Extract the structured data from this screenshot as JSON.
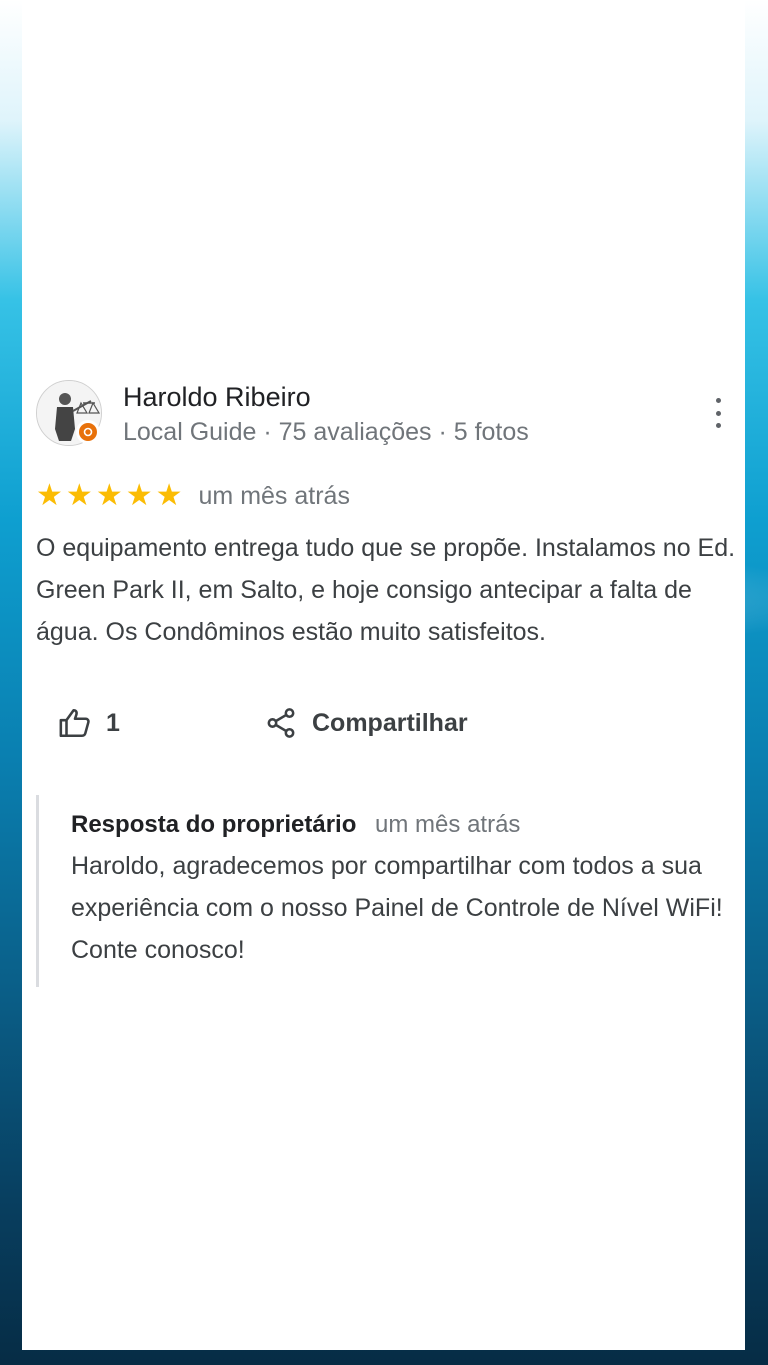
{
  "review": {
    "author": "Haroldo Ribeiro",
    "author_meta": "Local Guide · 75 avaliações · 5 fotos",
    "rating": 5,
    "time": "um mês atrás",
    "text": "O equipamento entrega tudo que se propõe. Instalamos no Ed. Green Park II, em Salto, e hoje consigo antecipar a falta de água. Os Condôminos estão muito satisfeitos.",
    "likes": "1",
    "share_label": "Compartilhar"
  },
  "owner_reply": {
    "title": "Resposta do proprietário",
    "time": "um mês atrás",
    "text": "Haroldo, agradecemos por compartilhar com todos a sua experiência com o nosso Painel de Controle de Nível WiFi! Conte conosco!"
  },
  "icons": {
    "avatar": "statue-avatar",
    "badge": "local-guide-badge-icon",
    "menu": "more-vert-icon",
    "star": "star-icon",
    "like": "thumb-up-icon",
    "share": "share-icon"
  },
  "colors": {
    "star": "#fbbc04",
    "badge": "#e8710a",
    "text": "#3c4043",
    "muted": "#70757a"
  }
}
